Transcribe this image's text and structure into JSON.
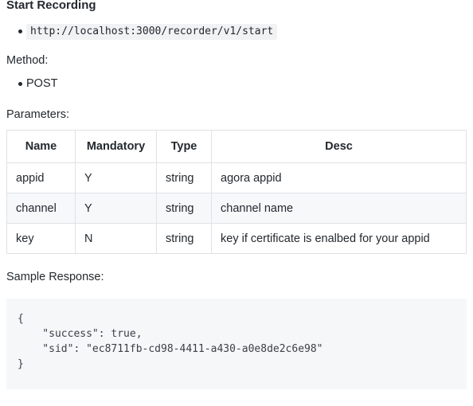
{
  "document": {
    "title": "Start Recording",
    "endpoint_list": [
      "http://localhost:3000/recorder/v1/start"
    ],
    "method_label": "Method:",
    "method_list": [
      "POST"
    ],
    "parameters_label": "Parameters:",
    "parameters_table": {
      "headers": [
        "Name",
        "Mandatory",
        "Type",
        "Desc"
      ],
      "rows": [
        {
          "name": "appid",
          "mandatory": "Y",
          "type": "string",
          "desc": "agora appid"
        },
        {
          "name": "channel",
          "mandatory": "Y",
          "type": "string",
          "desc": "channel name"
        },
        {
          "name": "key",
          "mandatory": "N",
          "type": "string",
          "desc": "key if certificate is enalbed for your appid"
        }
      ]
    },
    "sample_response_label": "Sample Response:",
    "sample_response_code": "{\n    \"success\": true,\n    \"sid\": \"ec8711fb-cd98-4411-a430-a0e8de2c6e98\"\n}"
  },
  "colors": {
    "text": "#24292e",
    "table_border": "#dfe2e5",
    "row_stripe": "#f6f8fa",
    "code_block_bg": "#f6f7f9",
    "inline_code_bg": "#f1f2f3",
    "code_text": "#3b4048"
  }
}
